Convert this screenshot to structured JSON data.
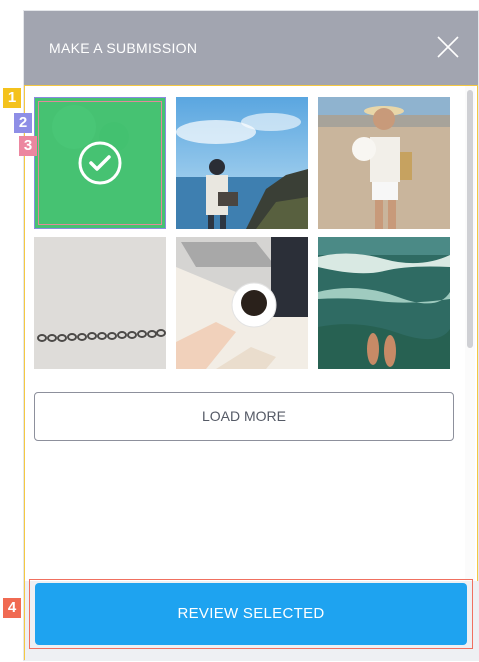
{
  "modal": {
    "title": "MAKE A SUBMISSION",
    "close_icon": "close-icon"
  },
  "gallery": {
    "images": [
      {
        "description": "green selected tile",
        "selected": true
      },
      {
        "description": "man on cliff by ocean",
        "selected": false
      },
      {
        "description": "woman holding small dog on beach",
        "selected": false
      },
      {
        "description": "ring chain on white",
        "selected": false
      },
      {
        "description": "coffee cup on laptop",
        "selected": false
      },
      {
        "description": "feet in ocean waves",
        "selected": false
      }
    ],
    "check_icon": "checkmark-circle-icon"
  },
  "buttons": {
    "load_more": "LOAD MORE",
    "review_selected": "REVIEW SELECTED"
  },
  "markers": [
    "1",
    "2",
    "3",
    "4"
  ],
  "colors": {
    "header_bg": "#a2a5b0",
    "selected_green": "#3cc86e",
    "primary_blue": "#1ea3f0",
    "marker_1": "#f4c21c",
    "marker_2": "#8e8ee6",
    "marker_3": "#ec87a0",
    "marker_4": "#f06a52"
  }
}
